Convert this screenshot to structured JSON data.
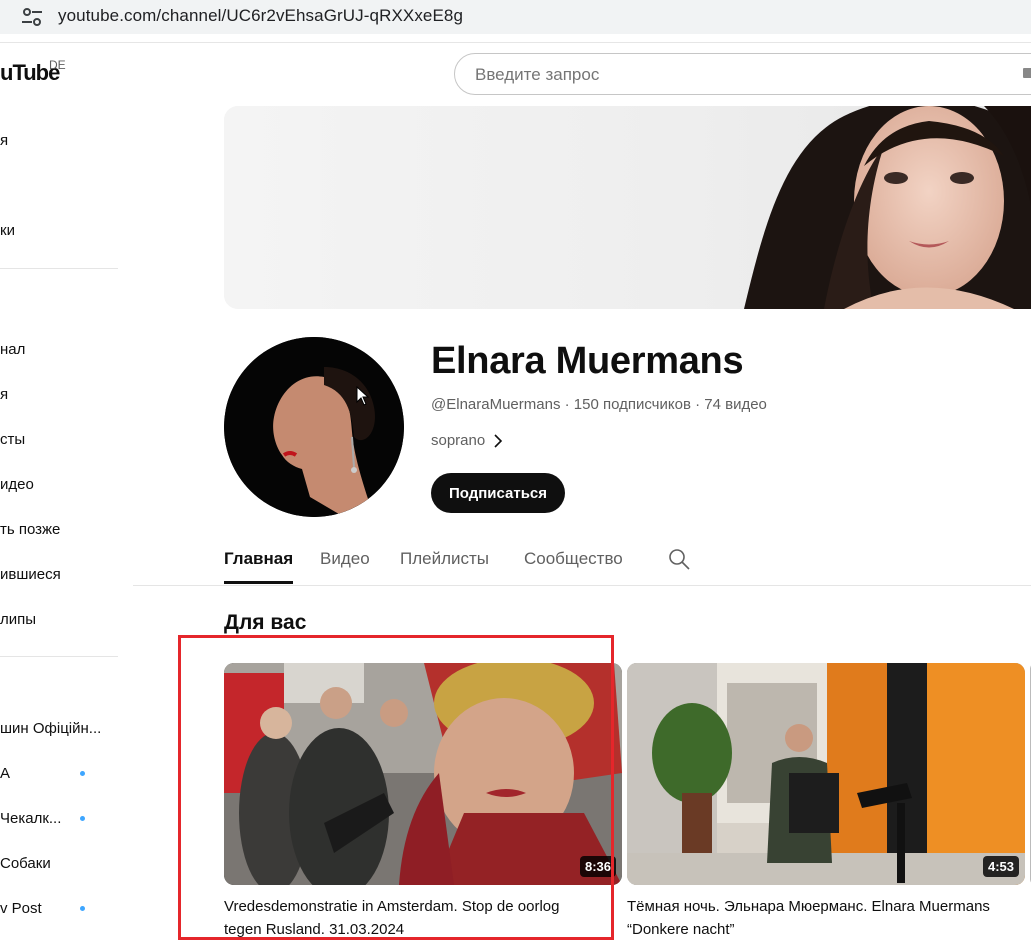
{
  "browser": {
    "url": "youtube.com/channel/UC6r2vEhsaGrUJ-qRXXxeE8g"
  },
  "logo": {
    "text": "uTube",
    "region": "DE"
  },
  "search": {
    "placeholder": "Введите запрос"
  },
  "sidebar": {
    "items_top": [
      {
        "label": "я"
      },
      {
        "label": "ки"
      }
    ],
    "items_you": [
      {
        "label": "нал"
      },
      {
        "label": "я"
      },
      {
        "label": "сты"
      },
      {
        "label": "идео"
      },
      {
        "label": "ть позже"
      },
      {
        "label": "ившиеся"
      },
      {
        "label": "липы"
      }
    ],
    "subscriptions": [
      {
        "label": "шин Офіційн...",
        "new": false
      },
      {
        "label": "A",
        "new": true
      },
      {
        "label": "Чекалк...",
        "new": true
      },
      {
        "label": "Собаки",
        "new": false
      },
      {
        "label": "v Post",
        "new": true
      }
    ]
  },
  "channel": {
    "name": "Elnara Muermans",
    "meta": "@ElnaraMuermans · 150 подписчиков · 74 видео",
    "description": "soprano",
    "subscribe_label": "Подписаться"
  },
  "tabs": [
    {
      "label": "Главная",
      "active": true
    },
    {
      "label": "Видео",
      "active": false
    },
    {
      "label": "Плейлисты",
      "active": false
    },
    {
      "label": "Сообщество",
      "active": false
    }
  ],
  "section": {
    "title": "Для вас"
  },
  "videos": [
    {
      "title": "Vredesdemonstratie in Amsterdam. Stop de oorlog tegen Rusland. 31.03.2024",
      "duration": "8:36"
    },
    {
      "title": "Тёмная ночь. Эльнара Мюерманс. Elnara Muermans “Donkere nacht”",
      "duration": "4:53"
    }
  ],
  "colors": {
    "accent": "#0f0f0f",
    "highlight": "#e5262b",
    "new_dot": "#3ea6ff"
  }
}
